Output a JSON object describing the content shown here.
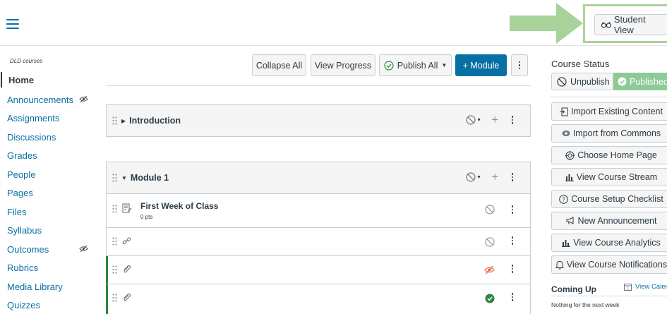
{
  "header": {
    "student_view_label": "Student View"
  },
  "course": {
    "name": "DLD courses"
  },
  "nav": {
    "items": [
      {
        "label": "Home",
        "active": true
      },
      {
        "label": "Announcements",
        "hidden": true
      },
      {
        "label": "Assignments"
      },
      {
        "label": "Discussions"
      },
      {
        "label": "Grades"
      },
      {
        "label": "People"
      },
      {
        "label": "Pages"
      },
      {
        "label": "Files"
      },
      {
        "label": "Syllabus"
      },
      {
        "label": "Outcomes",
        "hidden": true
      },
      {
        "label": "Rubrics"
      },
      {
        "label": "Media Library"
      },
      {
        "label": "Quizzes"
      }
    ]
  },
  "toolbar": {
    "collapse_all": "Collapse All",
    "view_progress": "View Progress",
    "publish_all": "Publish All",
    "add_module": "+ Module"
  },
  "modules": [
    {
      "title": "Introduction",
      "collapsed": true
    },
    {
      "title": "Module 1",
      "collapsed": false,
      "items": [
        {
          "title": "First Week of Class",
          "points": "0 pts",
          "type": "assignment",
          "state": "unpublished"
        },
        {
          "title": "",
          "type": "link",
          "state": "unpublished"
        },
        {
          "title": "",
          "type": "attachment",
          "state": "hidden",
          "published_bar": true
        },
        {
          "title": "",
          "type": "attachment",
          "state": "published",
          "published_bar": true
        }
      ]
    }
  ],
  "sidebar": {
    "course_status_title": "Course Status",
    "unpublish_label": "Unpublish",
    "published_label": "Published",
    "buttons": [
      {
        "label": "Import Existing Content",
        "icon": "import-icon"
      },
      {
        "label": "Import from Commons",
        "icon": "commons-icon"
      },
      {
        "label": "Choose Home Page",
        "icon": "target-icon"
      },
      {
        "label": "View Course Stream",
        "icon": "stream-icon"
      },
      {
        "label": "Course Setup Checklist",
        "icon": "question-icon"
      },
      {
        "label": "New Announcement",
        "icon": "megaphone-icon"
      },
      {
        "label": "View Course Analytics",
        "icon": "analytics-icon"
      },
      {
        "label": "View Course Notifications",
        "icon": "bell-icon"
      }
    ],
    "coming_up_title": "Coming Up",
    "view_calendar_label": "View Calendar",
    "nothing_label": "Nothing for the next week"
  },
  "colors": {
    "link_blue": "#0770a3",
    "text": "#2d3b45",
    "published_green": "#2e8540",
    "published_btn": "#8dca96",
    "hidden_orange": "#e66135",
    "callout_green": "#a9d29b"
  }
}
